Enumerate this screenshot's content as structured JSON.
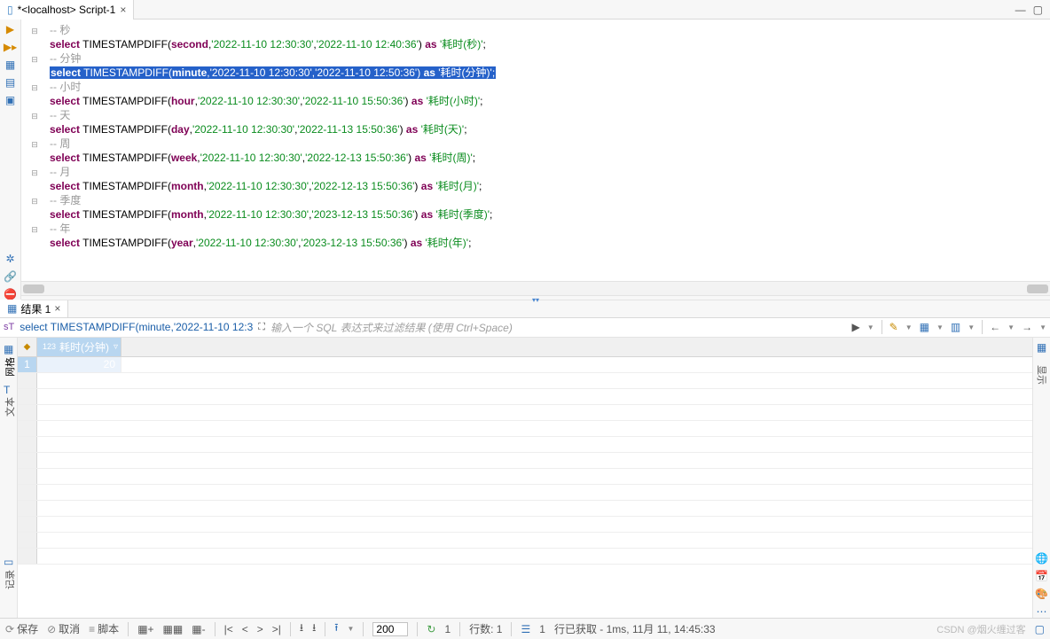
{
  "tab": {
    "title": "*<localhost> Script-1"
  },
  "code": {
    "lines": [
      {
        "type": "comment",
        "text": "-- 秒"
      },
      {
        "type": "sql",
        "kw": "select",
        "fn": "TIMESTAMPDIFF",
        "unit": "second",
        "d1": "'2022-11-10 12:30:30'",
        "d2": "'2022-11-10 12:40:36'",
        "as": "as",
        "alias": "'耗时(秒)'"
      },
      {
        "type": "comment",
        "text": "-- 分钟"
      },
      {
        "type": "sql",
        "sel": true,
        "kw": "select",
        "fn": "TIMESTAMPDIFF",
        "unit": "minute",
        "d1": "'2022-11-10 12:30:30'",
        "d2": "'2022-11-10 12:50:36'",
        "as": "as",
        "alias": "'耗时(分钟)'"
      },
      {
        "type": "comment",
        "text": "-- 小时"
      },
      {
        "type": "sql",
        "kw": "select",
        "fn": "TIMESTAMPDIFF",
        "unit": "hour",
        "d1": "'2022-11-10 12:30:30'",
        "d2": "'2022-11-10 15:50:36'",
        "as": "as",
        "alias": "'耗时(小时)'"
      },
      {
        "type": "comment",
        "text": "-- 天"
      },
      {
        "type": "sql",
        "kw": "select",
        "fn": "TIMESTAMPDIFF",
        "unit": "day",
        "d1": "'2022-11-10 12:30:30'",
        "d2": "'2022-11-13 15:50:36'",
        "as": "as",
        "alias": "'耗时(天)'"
      },
      {
        "type": "comment",
        "text": "-- 周"
      },
      {
        "type": "sql",
        "kw": "select",
        "fn": "TIMESTAMPDIFF",
        "unit": "week",
        "d1": "'2022-11-10 12:30:30'",
        "d2": "'2022-12-13 15:50:36'",
        "as": "as",
        "alias": "'耗时(周)'"
      },
      {
        "type": "comment",
        "text": "-- 月"
      },
      {
        "type": "sql",
        "kw": "select",
        "fn": "TIMESTAMPDIFF",
        "unit": "month",
        "d1": "'2022-11-10 12:30:30'",
        "d2": "'2022-12-13 15:50:36'",
        "as": "as",
        "alias": "'耗时(月)'"
      },
      {
        "type": "comment",
        "text": "-- 季度"
      },
      {
        "type": "sql",
        "kw": "select",
        "fn": "TIMESTAMPDIFF",
        "unit": "month",
        "d1": "'2022-11-10 12:30:30'",
        "d2": "'2023-12-13 15:50:36'",
        "as": "as",
        "alias": "'耗时(季度)'"
      },
      {
        "type": "comment",
        "text": "-- 年"
      },
      {
        "type": "sql",
        "kw": "select",
        "fn": "TIMESTAMPDIFF",
        "unit": "year",
        "d1": "'2022-11-10 12:30:30'",
        "d2": "'2023-12-13 15:50:36'",
        "as": "as",
        "alias": "'耗时(年)'"
      }
    ]
  },
  "results_tab": {
    "label": "结果 1"
  },
  "breadcrumb": {
    "sql": "select TIMESTAMPDIFF(minute,'2022-11-10 12:3",
    "filter_placeholder": "输入一个 SQL 表达式来过滤结果 (使用 Ctrl+Space)"
  },
  "sidebar": {
    "grid": "网格",
    "text": "文本",
    "record": "记录"
  },
  "grid": {
    "type_prefix": "123",
    "col1": "耗时(分钟)",
    "row1": {
      "num": "1",
      "value": "20"
    }
  },
  "right_panel": {
    "panel": "显示"
  },
  "footer": {
    "save": "保存",
    "cancel": "取消",
    "script": "脚本",
    "fetch_size": "200",
    "refresh": "1",
    "rows": "行数: 1",
    "rows_sel": "1",
    "status": "行已获取 - 1ms, 11月 11, 14:45:33"
  },
  "watermark": "CSDN @烟火缠过客"
}
